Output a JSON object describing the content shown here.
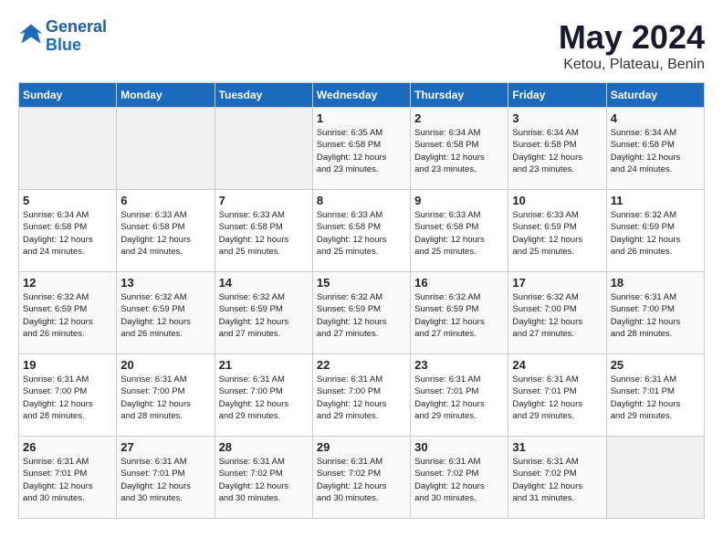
{
  "logo": {
    "line1": "General",
    "line2": "Blue"
  },
  "title": "May 2024",
  "location": "Ketou, Plateau, Benin",
  "days_header": [
    "Sunday",
    "Monday",
    "Tuesday",
    "Wednesday",
    "Thursday",
    "Friday",
    "Saturday"
  ],
  "weeks": [
    [
      {
        "num": "",
        "info": ""
      },
      {
        "num": "",
        "info": ""
      },
      {
        "num": "",
        "info": ""
      },
      {
        "num": "1",
        "info": "Sunrise: 6:35 AM\nSunset: 6:58 PM\nDaylight: 12 hours\nand 23 minutes."
      },
      {
        "num": "2",
        "info": "Sunrise: 6:34 AM\nSunset: 6:58 PM\nDaylight: 12 hours\nand 23 minutes."
      },
      {
        "num": "3",
        "info": "Sunrise: 6:34 AM\nSunset: 6:58 PM\nDaylight: 12 hours\nand 23 minutes."
      },
      {
        "num": "4",
        "info": "Sunrise: 6:34 AM\nSunset: 6:58 PM\nDaylight: 12 hours\nand 24 minutes."
      }
    ],
    [
      {
        "num": "5",
        "info": "Sunrise: 6:34 AM\nSunset: 6:58 PM\nDaylight: 12 hours\nand 24 minutes."
      },
      {
        "num": "6",
        "info": "Sunrise: 6:33 AM\nSunset: 6:58 PM\nDaylight: 12 hours\nand 24 minutes."
      },
      {
        "num": "7",
        "info": "Sunrise: 6:33 AM\nSunset: 6:58 PM\nDaylight: 12 hours\nand 25 minutes."
      },
      {
        "num": "8",
        "info": "Sunrise: 6:33 AM\nSunset: 6:58 PM\nDaylight: 12 hours\nand 25 minutes."
      },
      {
        "num": "9",
        "info": "Sunrise: 6:33 AM\nSunset: 6:58 PM\nDaylight: 12 hours\nand 25 minutes."
      },
      {
        "num": "10",
        "info": "Sunrise: 6:33 AM\nSunset: 6:59 PM\nDaylight: 12 hours\nand 25 minutes."
      },
      {
        "num": "11",
        "info": "Sunrise: 6:32 AM\nSunset: 6:59 PM\nDaylight: 12 hours\nand 26 minutes."
      }
    ],
    [
      {
        "num": "12",
        "info": "Sunrise: 6:32 AM\nSunset: 6:59 PM\nDaylight: 12 hours\nand 26 minutes."
      },
      {
        "num": "13",
        "info": "Sunrise: 6:32 AM\nSunset: 6:59 PM\nDaylight: 12 hours\nand 26 minutes."
      },
      {
        "num": "14",
        "info": "Sunrise: 6:32 AM\nSunset: 6:59 PM\nDaylight: 12 hours\nand 27 minutes."
      },
      {
        "num": "15",
        "info": "Sunrise: 6:32 AM\nSunset: 6:59 PM\nDaylight: 12 hours\nand 27 minutes."
      },
      {
        "num": "16",
        "info": "Sunrise: 6:32 AM\nSunset: 6:59 PM\nDaylight: 12 hours\nand 27 minutes."
      },
      {
        "num": "17",
        "info": "Sunrise: 6:32 AM\nSunset: 7:00 PM\nDaylight: 12 hours\nand 27 minutes."
      },
      {
        "num": "18",
        "info": "Sunrise: 6:31 AM\nSunset: 7:00 PM\nDaylight: 12 hours\nand 28 minutes."
      }
    ],
    [
      {
        "num": "19",
        "info": "Sunrise: 6:31 AM\nSunset: 7:00 PM\nDaylight: 12 hours\nand 28 minutes."
      },
      {
        "num": "20",
        "info": "Sunrise: 6:31 AM\nSunset: 7:00 PM\nDaylight: 12 hours\nand 28 minutes."
      },
      {
        "num": "21",
        "info": "Sunrise: 6:31 AM\nSunset: 7:00 PM\nDaylight: 12 hours\nand 29 minutes."
      },
      {
        "num": "22",
        "info": "Sunrise: 6:31 AM\nSunset: 7:00 PM\nDaylight: 12 hours\nand 29 minutes."
      },
      {
        "num": "23",
        "info": "Sunrise: 6:31 AM\nSunset: 7:01 PM\nDaylight: 12 hours\nand 29 minutes."
      },
      {
        "num": "24",
        "info": "Sunrise: 6:31 AM\nSunset: 7:01 PM\nDaylight: 12 hours\nand 29 minutes."
      },
      {
        "num": "25",
        "info": "Sunrise: 6:31 AM\nSunset: 7:01 PM\nDaylight: 12 hours\nand 29 minutes."
      }
    ],
    [
      {
        "num": "26",
        "info": "Sunrise: 6:31 AM\nSunset: 7:01 PM\nDaylight: 12 hours\nand 30 minutes."
      },
      {
        "num": "27",
        "info": "Sunrise: 6:31 AM\nSunset: 7:01 PM\nDaylight: 12 hours\nand 30 minutes."
      },
      {
        "num": "28",
        "info": "Sunrise: 6:31 AM\nSunset: 7:02 PM\nDaylight: 12 hours\nand 30 minutes."
      },
      {
        "num": "29",
        "info": "Sunrise: 6:31 AM\nSunset: 7:02 PM\nDaylight: 12 hours\nand 30 minutes."
      },
      {
        "num": "30",
        "info": "Sunrise: 6:31 AM\nSunset: 7:02 PM\nDaylight: 12 hours\nand 30 minutes."
      },
      {
        "num": "31",
        "info": "Sunrise: 6:31 AM\nSunset: 7:02 PM\nDaylight: 12 hours\nand 31 minutes."
      },
      {
        "num": "",
        "info": ""
      }
    ]
  ]
}
